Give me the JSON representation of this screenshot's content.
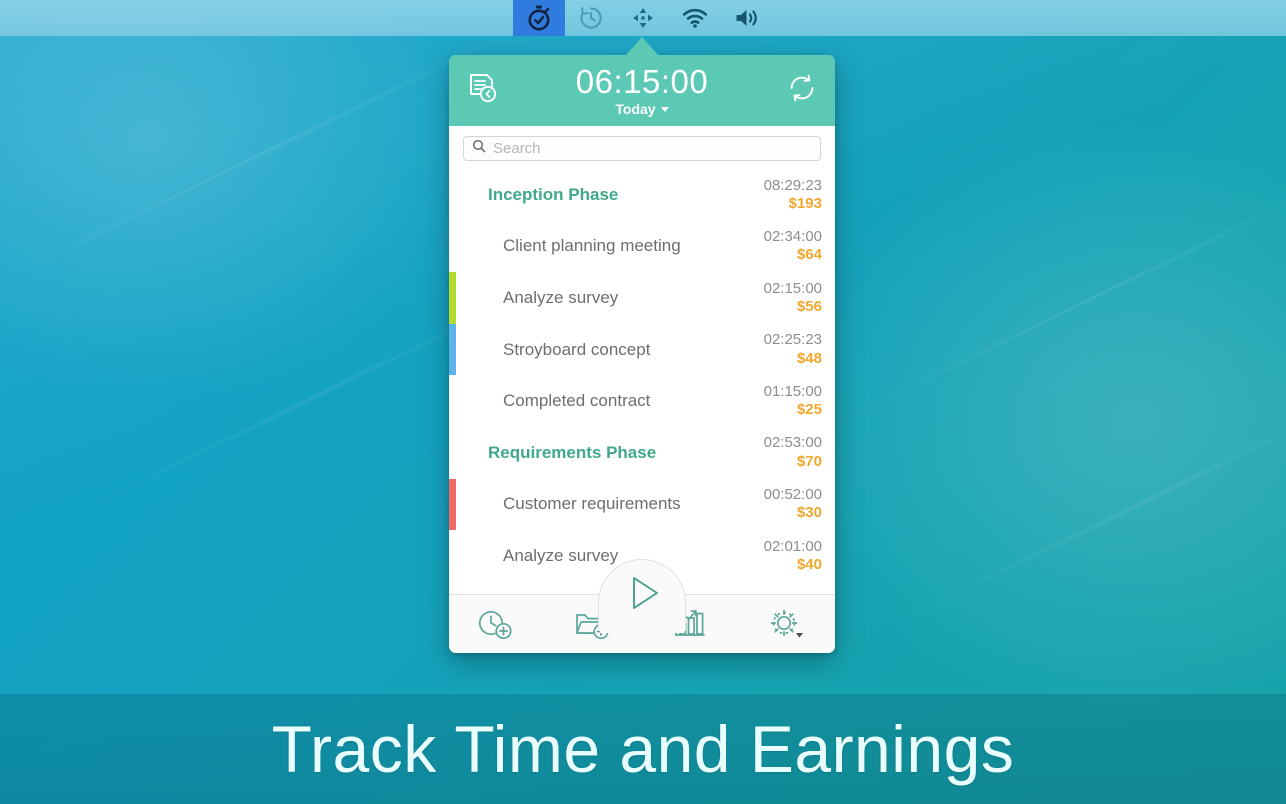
{
  "menubar": {
    "items": [
      {
        "name": "stopwatch-icon",
        "label": "Timing app menu bar icon",
        "active": true
      },
      {
        "name": "clock-history-icon",
        "label": "Time Machine",
        "active": false
      },
      {
        "name": "arrows-move-icon",
        "label": "Displays arrangement",
        "active": false
      },
      {
        "name": "wifi-icon",
        "label": "Wi-Fi",
        "active": false
      },
      {
        "name": "volume-icon",
        "label": "Volume",
        "active": false
      }
    ]
  },
  "panel": {
    "header": {
      "report_icon_label": "Reports",
      "timer": "06:15:00",
      "day": "Today",
      "refresh_icon_label": "Sync"
    },
    "search": {
      "placeholder": "Search",
      "value": ""
    },
    "rows": [
      {
        "type": "group",
        "label": "Inception Phase",
        "time": "08:29:23",
        "money": "$193",
        "color": ""
      },
      {
        "type": "task",
        "label": "Client planning meeting",
        "time": "02:34:00",
        "money": "$64",
        "color": ""
      },
      {
        "type": "task",
        "label": "Analyze survey",
        "time": "02:15:00",
        "money": "$56",
        "color": "#b2d92b"
      },
      {
        "type": "task",
        "label": "Stroyboard concept",
        "time": "02:25:23",
        "money": "$48",
        "color": "#5cb4e8"
      },
      {
        "type": "task",
        "label": "Completed contract",
        "time": "01:15:00",
        "money": "$25",
        "color": ""
      },
      {
        "type": "group",
        "label": "Requirements Phase",
        "time": "02:53:00",
        "money": "$70",
        "color": ""
      },
      {
        "type": "task",
        "label": "Customer requirements",
        "time": "00:52:00",
        "money": "$30",
        "color": "#ef6b6b"
      },
      {
        "type": "task",
        "label": "Analyze survey",
        "time": "02:01:00",
        "money": "$40",
        "color": ""
      }
    ],
    "toolbar": {
      "add_time_label": "Add time entry",
      "add_project_label": "Add project",
      "start_label": "Start timer",
      "stats_label": "Statistics",
      "settings_label": "Settings"
    }
  },
  "caption": {
    "text": "Track Time and Earnings"
  },
  "colors": {
    "header_green": "#5cc9b4",
    "group_text": "#3fa98a",
    "money": "#f0a72e",
    "time": "#8e8e8e",
    "menubar_active": "#2f7bde"
  }
}
